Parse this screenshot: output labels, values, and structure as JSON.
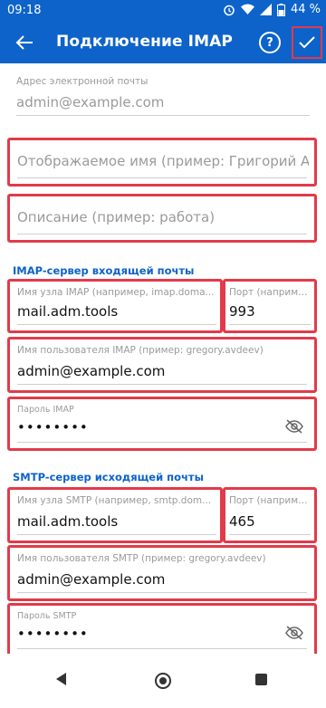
{
  "status_bar": {
    "time": "09:18",
    "battery": "44 %"
  },
  "app_bar": {
    "title": "Подключение IMAP",
    "help_icon_label": "?"
  },
  "email": {
    "label": "Адрес электронной почты",
    "value": "admin@example.com"
  },
  "display_name": {
    "placeholder": "Отображаемое имя (пример: Григорий Ав..."
  },
  "description": {
    "placeholder": "Описание (пример: работа)"
  },
  "imap": {
    "section_title": "IMAP-сервер входящей почты",
    "host": {
      "label": "Имя узла IMAP (например, imap.doma...",
      "value": "mail.adm.tools"
    },
    "port": {
      "label": "Порт (наприме...",
      "value": "993"
    },
    "username": {
      "label": "Имя пользователя IMAP (пример: gregory.avdeev)",
      "value": "admin@example.com"
    },
    "password": {
      "label": "Пароль IMAP",
      "value": "••••••••"
    }
  },
  "smtp": {
    "section_title": "SMTP-сервер исходящей почты",
    "host": {
      "label": "Имя узла SMTP (например, smtp.dom...",
      "value": "mail.adm.tools"
    },
    "port": {
      "label": "Порт (наприме...",
      "value": "465"
    },
    "username": {
      "label": "Имя пользователя SMTP (пример: gregory.avdeev)",
      "value": "admin@example.com"
    },
    "password": {
      "label": "Пароль SMTP",
      "value": "••••••••"
    }
  },
  "icons": [
    "back-arrow-icon",
    "help-icon",
    "check-icon",
    "eye-off-icon",
    "alarm-icon",
    "wifi-icon",
    "signal-icon",
    "battery-icon"
  ],
  "colors": {
    "primary": "#0d63c9",
    "highlight": "#e23a4a"
  }
}
